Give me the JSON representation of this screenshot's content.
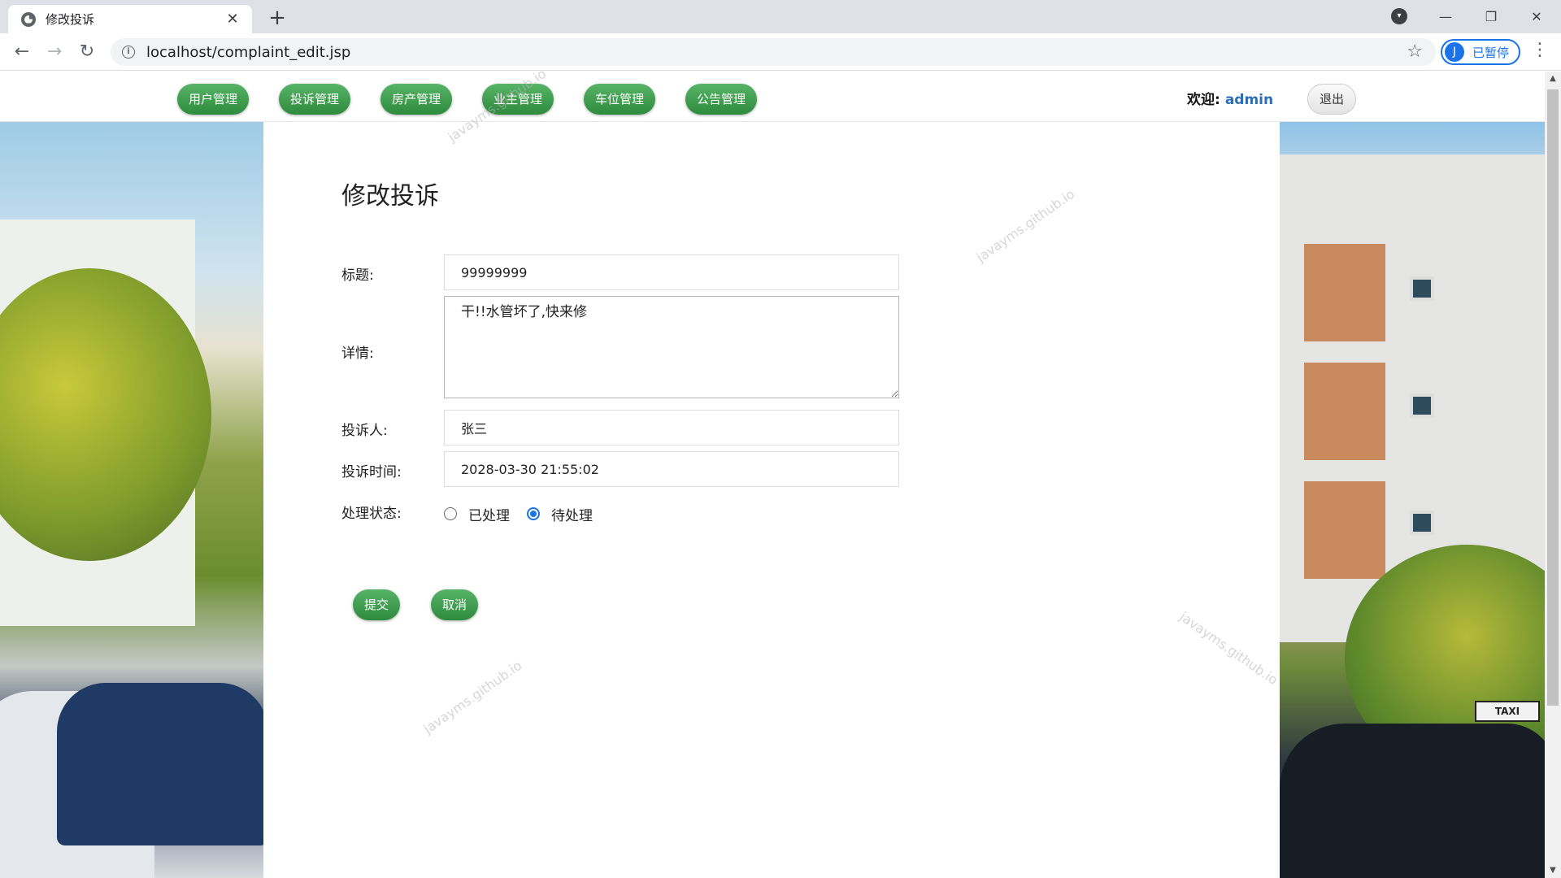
{
  "browser": {
    "tab_title": "修改投诉",
    "tab_close": "✕",
    "new_tab": "+",
    "url": "localhost/complaint_edit.jsp",
    "profile_initial": "J",
    "profile_status": "已暂停",
    "win_min": "—",
    "win_restore": "❐",
    "win_close": "✕"
  },
  "nav": {
    "menu": [
      "用户管理",
      "投诉管理",
      "房产管理",
      "业主管理",
      "车位管理",
      "公告管理"
    ],
    "welcome_label": "欢迎:",
    "username": "admin",
    "logout": "退出"
  },
  "form": {
    "title": "修改投诉",
    "title_label": "标题:",
    "title_value": "99999999",
    "detail_label": "详情:",
    "detail_value": "干!!水管坏了,快来修",
    "complainant_label": "投诉人:",
    "complainant_value": "张三",
    "time_label": "投诉时间:",
    "time_value": "2028-03-30 21:55:02",
    "status_label": "处理状态:",
    "status_options": [
      {
        "label": "已处理",
        "checked": false
      },
      {
        "label": "待处理",
        "checked": true
      }
    ],
    "submit": "提交",
    "cancel": "取消"
  },
  "photo_right": {
    "taxi_sign": "TAXI"
  },
  "watermark": "javayms.github.io",
  "colors": {
    "menu_green": "#3a9a4a",
    "link_blue": "#2e6db4",
    "radio_blue": "#1a73e8"
  }
}
